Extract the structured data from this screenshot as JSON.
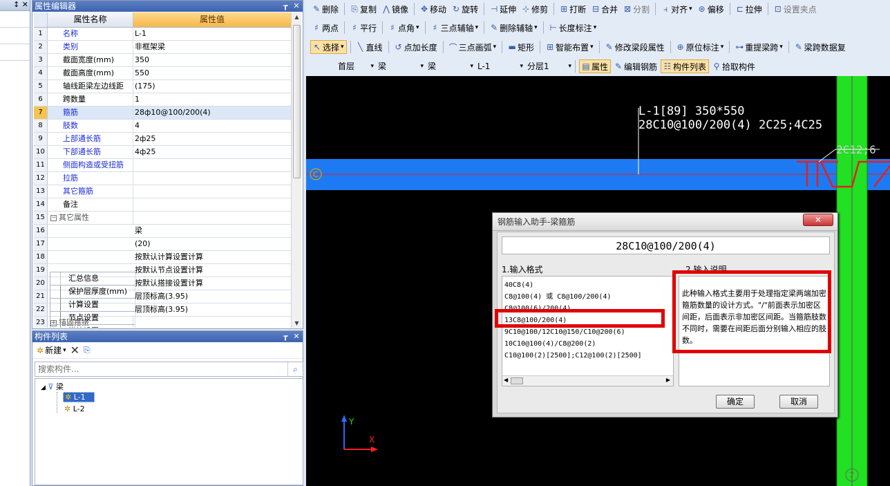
{
  "left_strip": {
    "pin_close": "↕ ✕"
  },
  "prop_editor": {
    "title": "属性编辑器",
    "pin": "┲",
    "close": "✕",
    "col_name": "属性名称",
    "col_value": "属性值",
    "rows": [
      {
        "n": "1",
        "k": "名称",
        "v": "L-1"
      },
      {
        "n": "2",
        "k": "类别",
        "v": "非框架梁"
      },
      {
        "n": "3",
        "k": "截面宽度(mm)",
        "v": "350"
      },
      {
        "n": "4",
        "k": "截面高度(mm)",
        "v": "550"
      },
      {
        "n": "5",
        "k": "轴线距梁左边线距",
        "v": "(175)"
      },
      {
        "n": "6",
        "k": "跨数量",
        "v": "1"
      },
      {
        "n": "7",
        "k": "箍筋",
        "v": "28ф10@100/200(4)"
      },
      {
        "n": "8",
        "k": "肢数",
        "v": "4"
      },
      {
        "n": "9",
        "k": "上部通长筋",
        "v": "2ф25"
      },
      {
        "n": "10",
        "k": "下部通长筋",
        "v": "4ф25"
      },
      {
        "n": "11",
        "k": "侧面构造或受扭筋",
        "v": ""
      },
      {
        "n": "12",
        "k": "拉筋",
        "v": ""
      },
      {
        "n": "13",
        "k": "其它箍筋",
        "v": ""
      },
      {
        "n": "14",
        "k": "备注",
        "v": ""
      },
      {
        "n": "15",
        "k": "其它属性",
        "v": ""
      },
      {
        "n": "16",
        "k": "汇总信息",
        "v": "梁"
      },
      {
        "n": "17",
        "k": "保护层厚度(mm)",
        "v": "(20)"
      },
      {
        "n": "18",
        "k": "计算设置",
        "v": "按默认计算设置计算"
      },
      {
        "n": "19",
        "k": "节点设置",
        "v": "按默认节点设置计算"
      },
      {
        "n": "20",
        "k": "搭接设置",
        "v": "按默认搭接设置计算"
      },
      {
        "n": "21",
        "k": "起点顶标高(m)",
        "v": "层顶标高(3.95)"
      },
      {
        "n": "22",
        "k": "终点顶标高(m)",
        "v": "层顶标高(3.95)"
      },
      {
        "n": "23",
        "k": "锚固搭接",
        "v": ""
      }
    ]
  },
  "comp_list": {
    "title": "构件列表",
    "new_label": "新建",
    "search_placeholder": "搜索构件...",
    "root": "梁",
    "items": [
      "L-1",
      "L-2"
    ]
  },
  "toolbar1": [
    {
      "icon": "✎",
      "label": "删除"
    },
    {
      "icon": "⎘",
      "label": "复制"
    },
    {
      "icon": "⋀",
      "label": "镜像"
    },
    {
      "icon": "✥",
      "label": "移动"
    },
    {
      "icon": "↻",
      "label": "旋转"
    },
    {
      "icon": "⊣",
      "label": "延伸"
    },
    {
      "icon": "⊹",
      "label": "修剪"
    },
    {
      "icon": "⊞",
      "label": "打断"
    },
    {
      "icon": "⊟",
      "label": "合并"
    },
    {
      "icon": "⊠",
      "label": "分割"
    },
    {
      "icon": "⫞",
      "label": "对齐"
    },
    {
      "icon": "⊛",
      "label": "偏移"
    },
    {
      "icon": "⊏",
      "label": "拉伸"
    },
    {
      "icon": "⊡",
      "label": "设置夹点"
    }
  ],
  "toolbar2": [
    {
      "icon": "♯",
      "label": "两点"
    },
    {
      "icon": "♯",
      "label": "平行"
    },
    {
      "icon": "♯",
      "label": "点角"
    },
    {
      "icon": "♯",
      "label": "三点辅轴"
    },
    {
      "icon": "✎",
      "label": "删除辅轴"
    },
    {
      "icon": "⊢",
      "label": "长度标注"
    }
  ],
  "toolbar3": [
    {
      "icon": "↖",
      "label": "选择"
    },
    {
      "icon": "╲",
      "label": "直线"
    },
    {
      "icon": "↺",
      "label": "点加长度"
    },
    {
      "icon": "⌒",
      "label": "三点画弧"
    },
    {
      "icon": "▬",
      "label": "矩形"
    },
    {
      "icon": "⊞",
      "label": "智能布置"
    },
    {
      "icon": "✎",
      "label": "修改梁段属性"
    },
    {
      "icon": "⊕",
      "label": "原位标注"
    },
    {
      "icon": "⊶",
      "label": "重提梁跨"
    },
    {
      "icon": "✎",
      "label": "梁跨数据复"
    }
  ],
  "toolbar4": {
    "floor": "首层",
    "type1": "梁",
    "type2": "梁",
    "comp": "L-1",
    "layer": "分层1",
    "btn_attr": "属性",
    "btn_edit": "编辑钢筋",
    "btn_list": "构件列表",
    "btn_pick": "拾取构件"
  },
  "canvas": {
    "beam_label_1": "L-1[89] 350*550",
    "beam_label_2": "28C10@100/200(4) 2C25;4C25",
    "side_label": "2C12;6",
    "axis_bubble": "C",
    "axis_y": "Y",
    "axis_x": "X",
    "grid_bubble": "7"
  },
  "dialog": {
    "title": "钢筋输入助手-梁箍筋",
    "close": "✕",
    "input_value": "28C10@100/200(4)",
    "format_label": "1.输入格式",
    "desc_label": "2.输入说明",
    "formats": [
      "40C8(4)",
      "C8@100(4) 或 C8@100/200(4)",
      "C8@100(6)/200(4)",
      "13C8@100/200(4)",
      "9C10@100/12C10@150/C10@200(6)",
      "10C10@100(4)/C8@200(2)",
      "C10@100(2)[2500];C12@100(2)[2500]"
    ],
    "description": "此种输入格式主要用于处理指定梁两端加密箍筋数量的设计方式。\"/\"前面表示加密区间距，后面表示非加密区间距。当箍筋肢数不同时，需要在间距后面分别输入相应的肢数。",
    "ok": "确定",
    "cancel": "取消"
  }
}
